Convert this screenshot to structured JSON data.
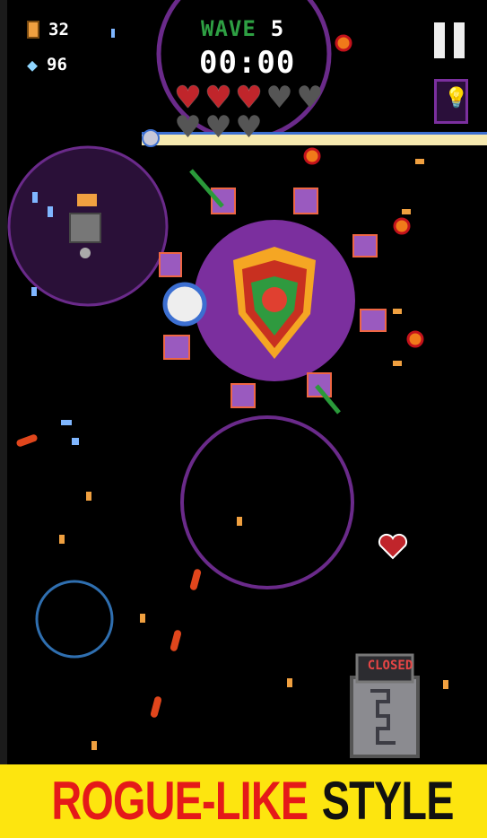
{
  "hud": {
    "coins": "32",
    "gems": "96",
    "wave_label": "WAVE",
    "wave_number": "5",
    "timer": "00:00",
    "hearts": [
      "full",
      "full",
      "full",
      "empty",
      "empty",
      "empty",
      "empty",
      "empty"
    ]
  },
  "icons": {
    "coin": "coin-icon",
    "gem": "diamond-icon",
    "pause": "pause-icon",
    "hint": "lightbulb-book-icon"
  },
  "gate": {
    "label": "CLOSED"
  },
  "banner": {
    "part1": "ROGUE-LIKE",
    "part2": "STYLE"
  },
  "colors": {
    "banner_bg": "#fde50f",
    "banner_red": "#e51919",
    "wave_green": "#2ea043",
    "boss_purple": "#7b2f9e",
    "heart_red": "#c0252b"
  }
}
